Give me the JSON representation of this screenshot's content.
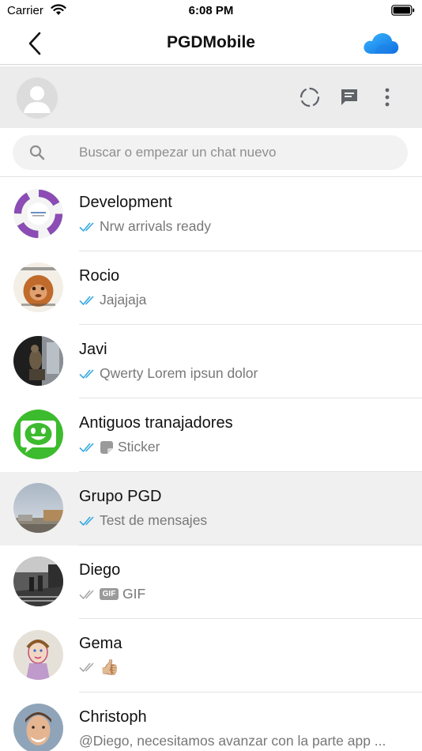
{
  "status_bar": {
    "carrier": "Carrier",
    "time": "6:08 PM"
  },
  "nav": {
    "title": "PGDMobile",
    "back_icon": "chevron-left-icon",
    "cloud_icon": "cloud-icon"
  },
  "header": {
    "status_icon": "status-ring-icon",
    "new_chat_icon": "chat-icon",
    "menu_icon": "more-vert-icon"
  },
  "search": {
    "placeholder": "Buscar o empezar un chat nuevo"
  },
  "colors": {
    "read_ticks": "#35a8e0",
    "unread_ticks": "#a8a8a8",
    "accent": "#1a8de9",
    "header_bg": "#ececec"
  },
  "chats": [
    {
      "name": "Development",
      "preview": "Nrw arrivals ready",
      "ticks": "read"
    },
    {
      "name": "Rocio",
      "preview": "Jajajaja",
      "ticks": "read"
    },
    {
      "name": "Javi",
      "preview": "Qwerty Lorem ipsun dolor",
      "ticks": "read"
    },
    {
      "name": "Antiguos tranajadores",
      "preview": "Sticker",
      "ticks": "read",
      "badge": "sticker-icon"
    },
    {
      "name": "Grupo PGD",
      "preview": "Test de mensajes",
      "ticks": "read",
      "selected": true
    },
    {
      "name": "Diego",
      "preview": "GIF",
      "ticks": "sent",
      "badge_label": "GIF"
    },
    {
      "name": "Gema",
      "preview": "👍🏼",
      "ticks": "sent"
    },
    {
      "name": "Christoph",
      "preview": "@Diego, necesitamos avanzar con la parte app ..."
    }
  ]
}
